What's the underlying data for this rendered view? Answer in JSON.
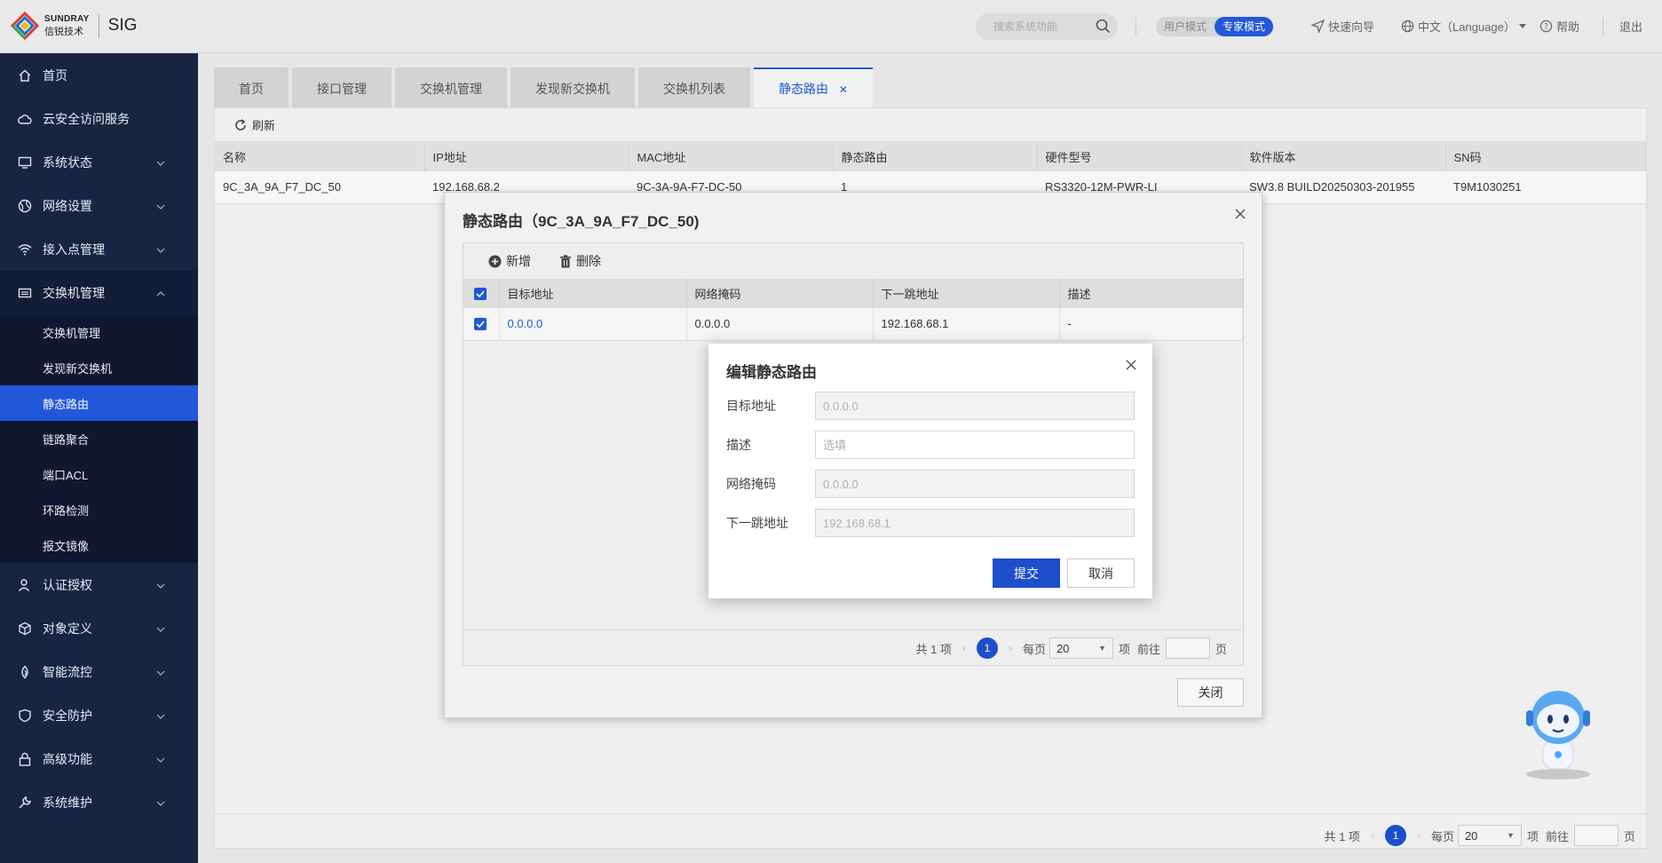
{
  "header": {
    "logo_en": "SUNDRAY",
    "logo_cn": "信锐技术",
    "product": "SIG",
    "search_placeholder": "搜索系统功能",
    "mode_user": "用户模式",
    "mode_expert": "专家模式",
    "quick_guide": "快速向导",
    "language": "中文（Language）",
    "help": "帮助",
    "logout": "退出",
    "accent_color": "#2157d9"
  },
  "sidebar": {
    "items": [
      {
        "label": "首页",
        "icon": "home-icon"
      },
      {
        "label": "云安全访问服务",
        "icon": "cloud-icon"
      },
      {
        "label": "系统状态",
        "icon": "monitor-icon"
      },
      {
        "label": "网络设置",
        "icon": "globe-icon"
      },
      {
        "label": "接入点管理",
        "icon": "wifi-icon"
      },
      {
        "label": "交换机管理",
        "icon": "switch-icon"
      }
    ],
    "subitems": [
      {
        "label": "交换机管理"
      },
      {
        "label": "发现新交换机"
      },
      {
        "label": "静态路由"
      },
      {
        "label": "链路聚合"
      },
      {
        "label": "端口ACL"
      },
      {
        "label": "环路检测"
      },
      {
        "label": "报文镜像"
      }
    ],
    "items2": [
      {
        "label": "认证授权",
        "icon": "user-icon"
      },
      {
        "label": "对象定义",
        "icon": "cube-icon"
      },
      {
        "label": "智能流控",
        "icon": "flow-icon"
      },
      {
        "label": "安全防护",
        "icon": "shield-icon"
      },
      {
        "label": "高级功能",
        "icon": "lock-icon"
      },
      {
        "label": "系统维护",
        "icon": "wrench-icon"
      }
    ]
  },
  "tabs": [
    {
      "label": "首页"
    },
    {
      "label": "接口管理"
    },
    {
      "label": "交换机管理"
    },
    {
      "label": "发现新交换机"
    },
    {
      "label": "交换机列表"
    },
    {
      "label": "静态路由"
    }
  ],
  "toolbar": {
    "refresh": "刷新"
  },
  "switch_table": {
    "columns": [
      "名称",
      "IP地址",
      "MAC地址",
      "静态路由",
      "硬件型号",
      "软件版本",
      "SN码"
    ],
    "row": {
      "name": "9C_3A_9A_F7_DC_50",
      "ip": "192.168.68.2",
      "mac": "9C-3A-9A-F7-DC-50",
      "routes": "1",
      "model": "RS3320-12M-PWR-LI",
      "version": "SW3.8 BUILD20250303-201955",
      "sn": "T9M1030251"
    }
  },
  "pager": {
    "total": "共 1 项",
    "page": "1",
    "per_page_label": "每页",
    "per_page": "20",
    "unit": "项",
    "goto": "前往",
    "page_unit": "页"
  },
  "route_dialog": {
    "title": "静态路由（9C_3A_9A_F7_DC_50)",
    "add": "新增",
    "delete": "删除",
    "columns": [
      "目标地址",
      "网络掩码",
      "下一跳地址",
      "描述"
    ],
    "row": {
      "dest": "0.0.0.0",
      "mask": "0.0.0.0",
      "next_hop": "192.168.68.1",
      "desc": "-"
    },
    "close": "关闭"
  },
  "edit_dialog": {
    "title": "编辑静态路由",
    "fields": [
      {
        "label": "目标地址",
        "placeholder": "0.0.0.0"
      },
      {
        "label": "描述",
        "placeholder": "选填"
      },
      {
        "label": "网络掩码",
        "placeholder": "0.0.0.0"
      },
      {
        "label": "下一跳地址",
        "placeholder": "192.168.68.1"
      }
    ],
    "submit": "提交",
    "cancel": "取消"
  }
}
